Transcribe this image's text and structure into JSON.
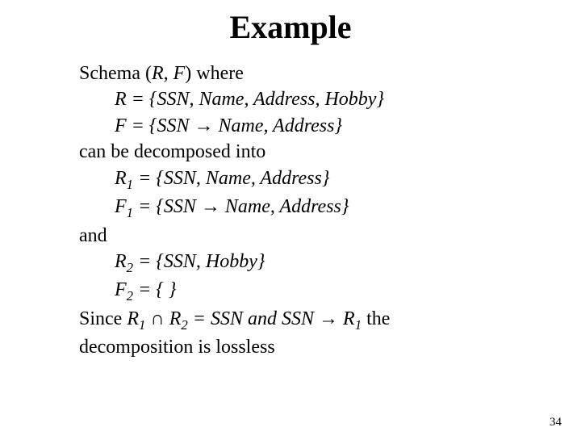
{
  "title": "Example",
  "lines": {
    "l1a": "Schema (",
    "l1b": "R, F",
    "l1c": ") where",
    "l2a": "R = ",
    "l2b": "{SSN, Name, Address, Hobby}",
    "l3a": "F = ",
    "l3b": "{SSN ",
    "l3arrow": "→",
    "l3c": "  Name, Address}",
    "l4": "can be decomposed into",
    "l5a": "R",
    "l5sub": "1",
    "l5b": " = {SSN, Name, Address}",
    "l6a": "F",
    "l6sub": "1",
    "l6b": " = {SSN ",
    "l6arrow": "→",
    "l6c": " Name, Address}",
    "l7": "and",
    "l8a": "R",
    "l8sub": "2",
    "l8b": " = {SSN, Hobby}",
    "l9a": "F",
    "l9sub": "2",
    "l9b": " = { }",
    "l10a": "Since ",
    "l10b": "R",
    "l10sub1": "1",
    "l10cap": " ∩ ",
    "l10c": "R",
    "l10sub2": "2",
    "l10d": " = SSN   and  SSN ",
    "l10arrow": "→",
    "l10e": " R",
    "l10sub3": "1",
    "l10f": " the",
    "l11": "decomposition is lossless"
  },
  "page_number": "34"
}
